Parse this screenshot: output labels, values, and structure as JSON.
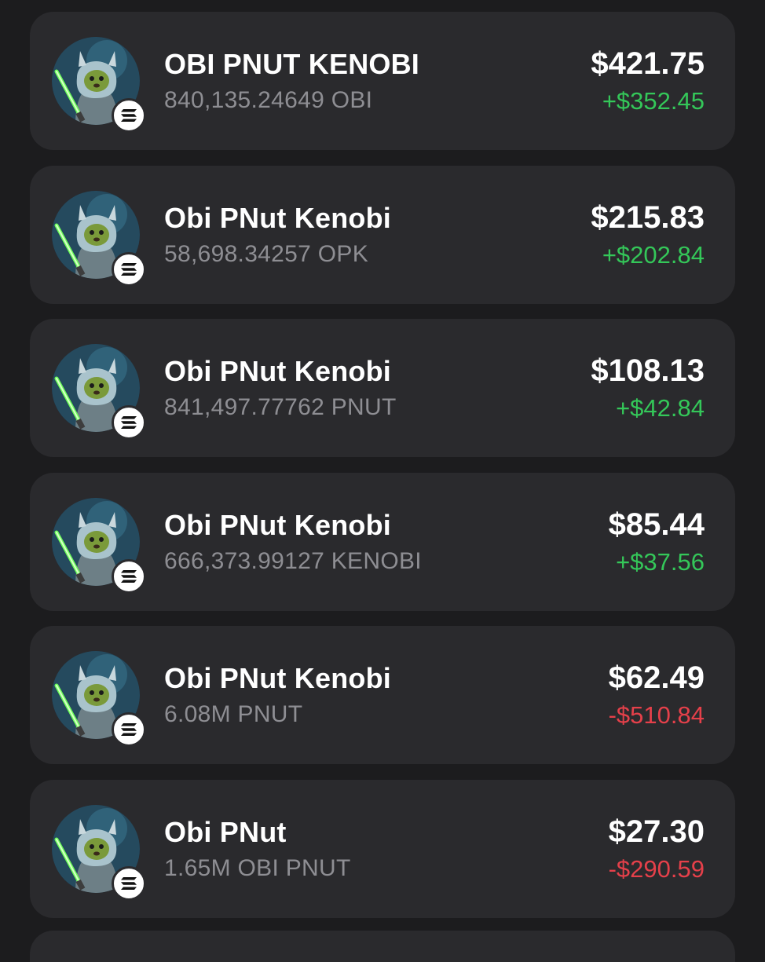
{
  "holdings": [
    {
      "name": "OBI PNUT KENOBI",
      "amount": "840,135.24649 OBI",
      "value": "$421.75",
      "change": "+$352.45",
      "direction": "up",
      "chain_icon": "solana-icon"
    },
    {
      "name": "Obi PNut Kenobi",
      "amount": "58,698.34257 OPK",
      "value": "$215.83",
      "change": "+$202.84",
      "direction": "up",
      "chain_icon": "solana-icon"
    },
    {
      "name": "Obi PNut Kenobi",
      "amount": "841,497.77762 PNUT",
      "value": "$108.13",
      "change": "+$42.84",
      "direction": "up",
      "chain_icon": "solana-icon"
    },
    {
      "name": "Obi PNut Kenobi",
      "amount": "666,373.99127 KENOBI",
      "value": "$85.44",
      "change": "+$37.56",
      "direction": "up",
      "chain_icon": "solana-icon"
    },
    {
      "name": "Obi PNut Kenobi",
      "amount": "6.08M PNUT",
      "value": "$62.49",
      "change": "-$510.84",
      "direction": "down",
      "chain_icon": "solana-icon"
    },
    {
      "name": "Obi PNut",
      "amount": "1.65M OBI PNUT",
      "value": "$27.30",
      "change": "-$290.59",
      "direction": "down",
      "chain_icon": "solana-icon"
    }
  ],
  "colors": {
    "background": "#1c1c1e",
    "card": "#2a2a2d",
    "positive": "#34c759",
    "negative": "#e5404a",
    "secondary_text": "#8e8e93"
  }
}
